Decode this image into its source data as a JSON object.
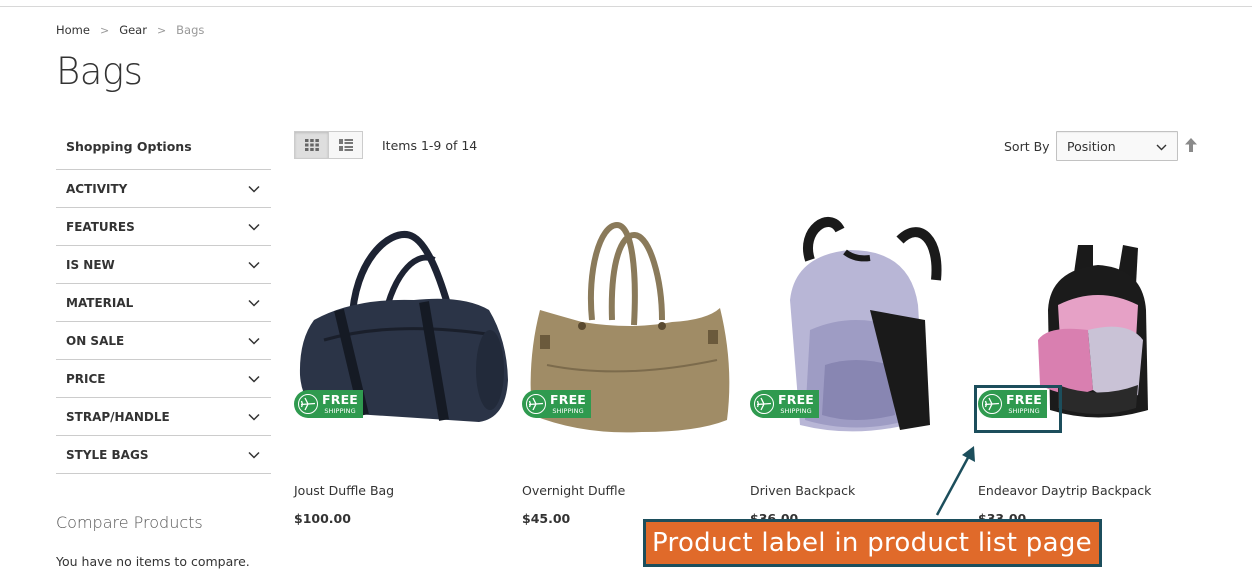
{
  "breadcrumb": {
    "home": "Home",
    "gear": "Gear",
    "current": "Bags",
    "separator": ">"
  },
  "page": {
    "title": "Bags"
  },
  "sidebar": {
    "title": "Shopping Options",
    "filters": [
      "ACTIVITY",
      "FEATURES",
      "IS NEW",
      "MATERIAL",
      "ON SALE",
      "PRICE",
      "STRAP/HANDLE",
      "STYLE BAGS"
    ]
  },
  "compare": {
    "title": "Compare Products",
    "empty": "You have no items to compare."
  },
  "toolbar": {
    "amount": "Items 1-9 of 14",
    "sort_label": "Sort By",
    "sort_value": "Position",
    "view_modes": [
      "grid-icon",
      "list-icon"
    ]
  },
  "products": [
    {
      "name": "Joust Duffle Bag",
      "price": "$100.00"
    },
    {
      "name": "Overnight Duffle",
      "price": "$45.00"
    },
    {
      "name": "Driven Backpack",
      "price": "$36.00"
    },
    {
      "name": "Endeavor Daytrip Backpack",
      "price": "$33.00"
    }
  ],
  "product_label": {
    "line1": "FREE",
    "line2": "SHIPPING",
    "color": "#2f9a4f",
    "icon": "airplane-icon"
  },
  "annotation": {
    "text": "Product label in product list page",
    "bg": "#e06a2a",
    "border": "#1c4e5c"
  }
}
